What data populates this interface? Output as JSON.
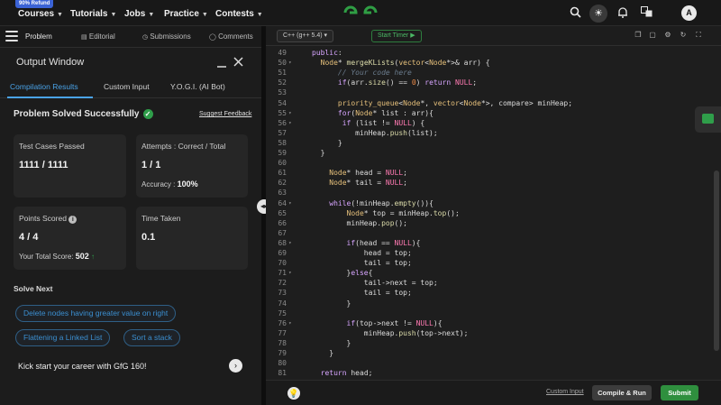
{
  "topbar": {
    "badge": "90% Refund",
    "nav": [
      {
        "label": "Courses"
      },
      {
        "label": "Tutorials"
      },
      {
        "label": "Jobs"
      },
      {
        "label": "Practice"
      },
      {
        "label": "Contests"
      }
    ],
    "avatar_letter": "A"
  },
  "left_tabs": {
    "problem": "Problem",
    "editorial": "Editorial",
    "submissions": "Submissions",
    "comments": "Comments"
  },
  "output": {
    "title": "Output Window",
    "tabs": [
      "Compilation Results",
      "Custom Input",
      "Y.O.G.I. (AI Bot)"
    ],
    "status": "Problem Solved Successfully",
    "feedback": "Suggest Feedback",
    "cards": {
      "tests_label": "Test Cases Passed",
      "tests_value": "1111 / 1111",
      "attempts_label": "Attempts : Correct / Total",
      "attempts_value": "1 / 1",
      "accuracy_label": "Accuracy :",
      "accuracy_value": "100%",
      "points_label": "Points Scored",
      "points_value": "4 / 4",
      "total_label": "Your Total Score:",
      "total_value": "502",
      "time_label": "Time Taken",
      "time_value": "0.1"
    },
    "solve_next": "Solve Next",
    "suggestions": [
      "Delete nodes having greater value on right",
      "Flattening a Linked List",
      "Sort a stack"
    ],
    "kick": "Kick start your career with GfG 160!"
  },
  "editor": {
    "language": "C++ (g++ 5.4)",
    "timer": "Start Timer",
    "custom_input": "Custom Input",
    "compile_run": "Compile & Run",
    "submit": "Submit"
  },
  "code_lines": [
    {
      "n": "49",
      "f": "",
      "html": "<span class=\"k\">public</span>:"
    },
    {
      "n": "50",
      "f": "▾",
      "html": "  <span class=\"t\">Node</span>* <span class=\"f\">mergeKLists</span>(<span class=\"t\">vector</span>&lt;<span class=\"t\">Node</span>*&gt;&amp; arr) {"
    },
    {
      "n": "51",
      "f": "",
      "html": "      <span class=\"c\">// Your code here</span>"
    },
    {
      "n": "52",
      "f": "",
      "html": "      <span class=\"k\">if</span>(arr.<span class=\"f\">size</span>() == <span class=\"n\">0</span>) <span class=\"k\">return</span> <span class=\"kw\">NULL</span>;"
    },
    {
      "n": "53",
      "f": "",
      "html": ""
    },
    {
      "n": "54",
      "f": "",
      "html": "      <span class=\"t\">priority_queue</span>&lt;<span class=\"t\">Node</span>*, <span class=\"t\">vector</span>&lt;<span class=\"t\">Node</span>*&gt;, compare&gt; minHeap;"
    },
    {
      "n": "55",
      "f": "▾",
      "html": "      <span class=\"k\">for</span>(<span class=\"t\">Node</span>* list : arr){"
    },
    {
      "n": "56",
      "f": "▾",
      "html": "       <span class=\"k\">if</span> (list != <span class=\"kw\">NULL</span>) {"
    },
    {
      "n": "57",
      "f": "",
      "html": "          minHeap.<span class=\"f\">push</span>(list);"
    },
    {
      "n": "58",
      "f": "",
      "html": "      }"
    },
    {
      "n": "59",
      "f": "",
      "html": "  }"
    },
    {
      "n": "60",
      "f": "",
      "html": ""
    },
    {
      "n": "61",
      "f": "",
      "html": "    <span class=\"t\">Node</span>* head = <span class=\"kw\">NULL</span>;"
    },
    {
      "n": "62",
      "f": "",
      "html": "    <span class=\"t\">Node</span>* tail = <span class=\"kw\">NULL</span>;"
    },
    {
      "n": "63",
      "f": "",
      "html": ""
    },
    {
      "n": "64",
      "f": "▾",
      "html": "    <span class=\"k\">while</span>(!minHeap.<span class=\"f\">empty</span>()){"
    },
    {
      "n": "65",
      "f": "",
      "html": "        <span class=\"t\">Node</span>* top = minHeap.<span class=\"f\">top</span>();"
    },
    {
      "n": "66",
      "f": "",
      "html": "        minHeap.<span class=\"f\">pop</span>();"
    },
    {
      "n": "67",
      "f": "",
      "html": ""
    },
    {
      "n": "68",
      "f": "▾",
      "html": "        <span class=\"k\">if</span>(head == <span class=\"kw\">NULL</span>){"
    },
    {
      "n": "69",
      "f": "",
      "html": "            head = top;"
    },
    {
      "n": "70",
      "f": "",
      "html": "            tail = top;"
    },
    {
      "n": "71",
      "f": "▾",
      "html": "        }<span class=\"k\">else</span>{"
    },
    {
      "n": "72",
      "f": "",
      "html": "            tail-&gt;next = top;"
    },
    {
      "n": "73",
      "f": "",
      "html": "            tail = top;"
    },
    {
      "n": "74",
      "f": "",
      "html": "        }"
    },
    {
      "n": "75",
      "f": "",
      "html": ""
    },
    {
      "n": "76",
      "f": "▾",
      "html": "        <span class=\"k\">if</span>(top-&gt;next != <span class=\"kw\">NULL</span>){"
    },
    {
      "n": "77",
      "f": "",
      "html": "            minHeap.<span class=\"f\">push</span>(top-&gt;next);"
    },
    {
      "n": "78",
      "f": "",
      "html": "        }"
    },
    {
      "n": "79",
      "f": "",
      "html": "    }"
    },
    {
      "n": "80",
      "f": "",
      "html": ""
    },
    {
      "n": "81",
      "f": "",
      "html": "  <span class=\"k\">return</span> head;"
    }
  ]
}
